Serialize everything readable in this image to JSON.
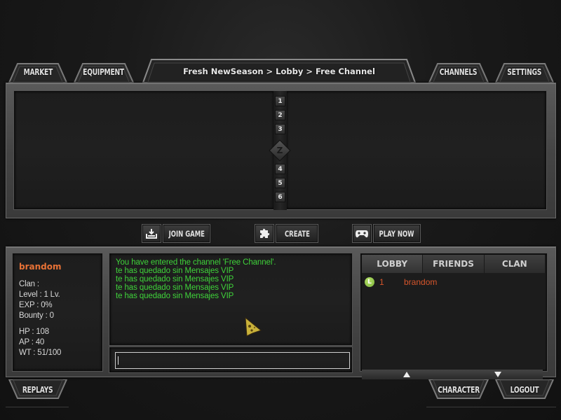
{
  "top_tabs": {
    "market": "MARKET",
    "equipment": "EQUIPMENT",
    "channels": "CHANNELS",
    "settings": "SETTINGS"
  },
  "breadcrumb": "Fresh NewSeason > Lobby > Free Channel",
  "room_pages": [
    "1",
    "2",
    "3",
    "4",
    "5",
    "6"
  ],
  "room_page_z": "Z",
  "actions": {
    "join_game": "JOIN GAME",
    "create": "CREATE",
    "play_now": "PLAY NOW",
    "join_icon": "download-tray-icon",
    "create_icon": "puzzle-piece-icon",
    "play_now_icon": "gamepad-icon"
  },
  "profile": {
    "name": "brandom",
    "name_color": "#e87236",
    "clan": "Clan :",
    "level": "Level : 1 Lv.",
    "exp": "EXP : 0%",
    "bounty": "Bounty : 0",
    "hp": "HP : 108",
    "ap": "AP : 40",
    "wt": "WT : 51/100"
  },
  "chat": {
    "color": "#3fd33a",
    "messages": [
      "You have entered the channel 'Free Channel'.",
      "te has quedado sin Mensajes VIP",
      "te has quedado sin Mensajes VIP",
      "te has quedado sin Mensajes VIP",
      "te has quedado sin Mensajes VIP"
    ],
    "input_value": ""
  },
  "players": {
    "tabs": [
      "LOBBY",
      "FRIENDS",
      "CLAN"
    ],
    "active_tab": "LOBBY",
    "rows": [
      {
        "badge": "L",
        "number": "1",
        "name": "brandom"
      }
    ]
  },
  "bottom_tabs": {
    "replays": "REPLAYS",
    "character": "CHARACTER",
    "logout": "LOGOUT"
  }
}
